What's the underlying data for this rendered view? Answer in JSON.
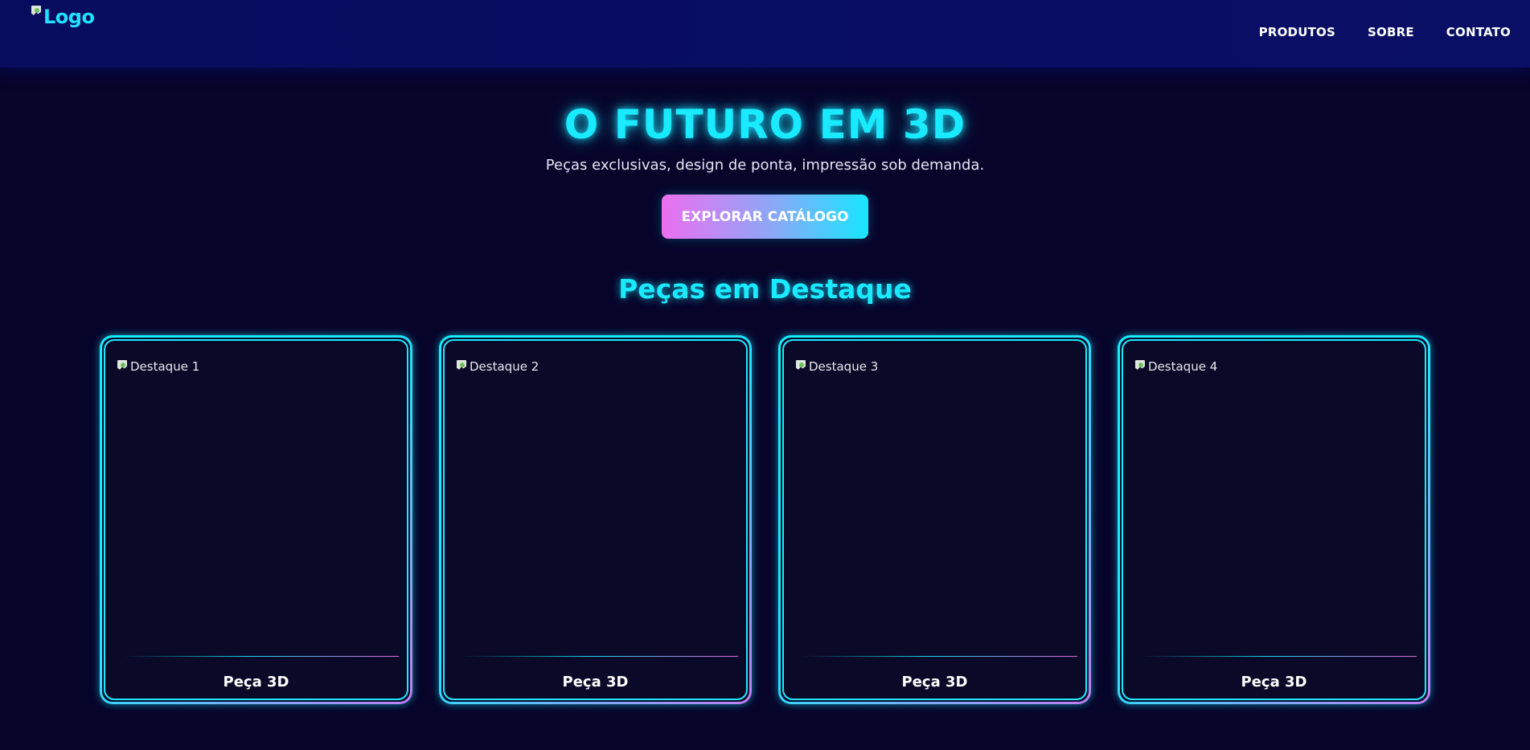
{
  "header": {
    "logo_alt": "Logo",
    "nav": [
      {
        "label": "PRODUTOS"
      },
      {
        "label": "SOBRE"
      },
      {
        "label": "CONTATO"
      }
    ]
  },
  "hero": {
    "title": "O FUTURO EM 3D",
    "subtitle": "Peças exclusivas, design de ponta, impressão sob demanda.",
    "cta_label": "EXPLORAR CATÁLOGO"
  },
  "featured": {
    "title": "Peças em Destaque",
    "cards": [
      {
        "image_alt": "Destaque 1",
        "title": "Peça 3D"
      },
      {
        "image_alt": "Destaque 2",
        "title": "Peça 3D"
      },
      {
        "image_alt": "Destaque 3",
        "title": "Peça 3D"
      },
      {
        "image_alt": "Destaque 4",
        "title": "Peça 3D"
      }
    ]
  },
  "colors": {
    "background": "#07042a",
    "navbar": "#070c5e",
    "accent_cyan": "#19eaff",
    "accent_pink": "#ec6ff0",
    "card_background": "#0a0a28"
  },
  "icons": {
    "broken_image": "broken-image-icon"
  }
}
